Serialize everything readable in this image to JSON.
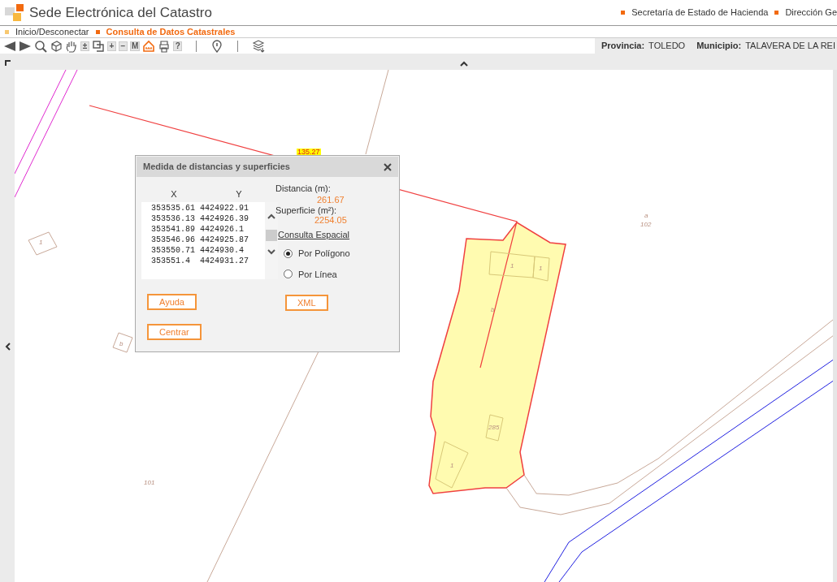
{
  "header": {
    "title": "Sede Electrónica del Catastro",
    "links": [
      "Secretaría de Estado de Hacienda",
      "Dirección Ge"
    ]
  },
  "nav": [
    {
      "label": "Inicio/Desconectar",
      "selected": false
    },
    {
      "label": "Consulta de Datos Catastrales",
      "selected": true
    }
  ],
  "toolbar": [
    {
      "kind": "back",
      "selected": false
    },
    {
      "kind": "forward",
      "selected": false
    },
    {
      "kind": "search",
      "selected": false
    },
    {
      "kind": "cube",
      "selected": false
    },
    {
      "kind": "hand",
      "selected": false
    },
    {
      "kind": "text",
      "label": "±",
      "selected": false
    },
    {
      "kind": "zoombox",
      "selected": false
    },
    {
      "kind": "text",
      "label": "+",
      "selected": false
    },
    {
      "kind": "text",
      "label": "−",
      "selected": false
    },
    {
      "kind": "text",
      "label": "M",
      "selected": false
    },
    {
      "kind": "measure",
      "selected": true
    },
    {
      "kind": "print",
      "selected": false
    },
    {
      "kind": "text",
      "label": "?",
      "selected": false
    },
    {
      "kind": "separator"
    },
    {
      "kind": "info",
      "selected": false
    },
    {
      "kind": "separator"
    },
    {
      "kind": "layers",
      "selected": false
    }
  ],
  "location": [
    {
      "label": "Provincia:",
      "value": "TOLEDO"
    },
    {
      "label": "Municipio:",
      "value": "TALAVERA DE LA REI"
    }
  ],
  "map": {
    "labels": [
      {
        "kind": "highlight",
        "text": "135.27"
      },
      {
        "kind": "plain",
        "text": "a"
      },
      {
        "kind": "plain",
        "text": "102"
      },
      {
        "kind": "plain",
        "text": "101"
      },
      {
        "kind": "plain",
        "text": "b"
      },
      {
        "kind": "plain",
        "text": "1"
      },
      {
        "kind": "plain",
        "text": "1"
      },
      {
        "kind": "plain",
        "text": "1"
      },
      {
        "kind": "plain",
        "text": "b"
      },
      {
        "kind": "plain",
        "text": "285"
      },
      {
        "kind": "plain",
        "text": "1"
      }
    ]
  },
  "dialog": {
    "title": "Medida de distancias y superficies",
    "columns": [
      "X",
      "Y"
    ],
    "rows": [
      [
        "353535.61",
        "4424922.91"
      ],
      [
        "353536.13",
        "4424926.39"
      ],
      [
        "353541.89",
        "4424926.1"
      ],
      [
        "353546.96",
        "4424925.87"
      ],
      [
        "353550.71",
        "4424930.4"
      ],
      [
        "353551.4",
        "4424931.27"
      ]
    ],
    "distance_label": "Distancia (m):",
    "distance": "261.67",
    "area_label": "Superficie (m²):",
    "area": "2254.05",
    "query_title": "Consulta Espacial",
    "query_options": [
      {
        "label": "Por Polígono",
        "selected": true
      },
      {
        "label": "Por Línea",
        "selected": false
      }
    ],
    "buttons": [
      "Ayuda",
      "Centrar",
      "XML"
    ]
  }
}
